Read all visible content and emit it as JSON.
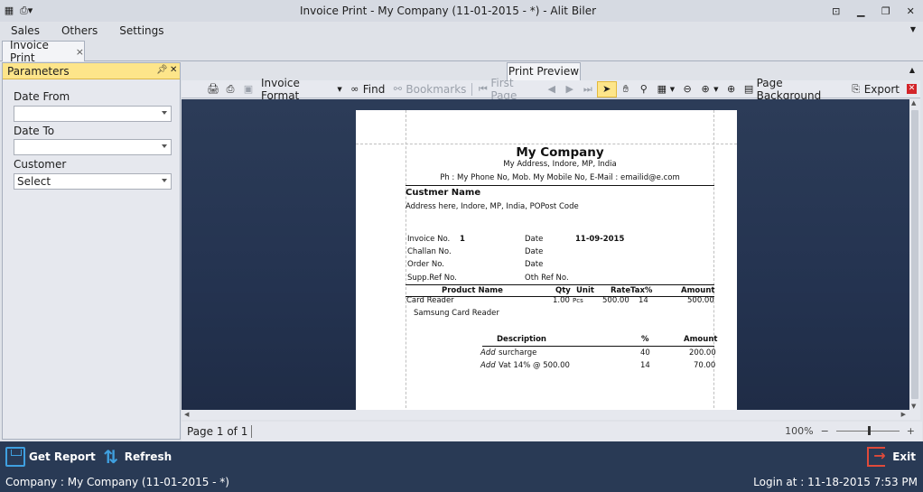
{
  "window": {
    "title": "Invoice Print - My Company (11-01-2015 - *) - Alit Biler",
    "controls": [
      "restore-down",
      "minimize",
      "maximize",
      "close"
    ]
  },
  "menu": {
    "items": [
      "Sales",
      "Others",
      "Settings"
    ]
  },
  "doc_tab": {
    "label": "Invoice Print",
    "close": "×"
  },
  "parameters": {
    "title": "Parameters",
    "date_from_label": "Date From",
    "date_from_value": "",
    "date_to_label": "Date To",
    "date_to_value": "",
    "customer_label": "Customer",
    "customer_value": "Select"
  },
  "preview": {
    "tab_label": "Print Preview",
    "toolbar": {
      "invoice_format": "Invoice Format",
      "find": "Find",
      "bookmarks": "Bookmarks",
      "first_page": "First Page",
      "page_background": "Page Background",
      "export": "Export"
    },
    "pager": "Page 1 of 1",
    "zoom": "100%",
    "zoom_level": 0.52
  },
  "invoice": {
    "company_name": "My Company",
    "address": "My Address, Indore, MP, India",
    "contact": "Ph : My Phone No, Mob. My Mobile No, E-Mail : emailid@e.com",
    "customer_name": "Custmer Name",
    "customer_address": "Address here, Indore, MP, India, POPost Code",
    "invoice_no_label": "Invoice No.",
    "invoice_no": "1",
    "date_label": "Date",
    "date": "11-09-2015",
    "challan_label": "Challan No.",
    "challan_date_label": "Date",
    "order_label": "Order No.",
    "order_date_label": "Date",
    "supp_ref_label": "Supp.Ref No.",
    "oth_ref_label": "Oth Ref No.",
    "items_header": {
      "product": "Product Name",
      "qty": "Qty",
      "unit": "Unit",
      "rate": "Rate",
      "tax": "Tax%",
      "amount": "Amount"
    },
    "item": {
      "product": "Card Reader",
      "qty": "1.00",
      "unit": "Pcs",
      "rate": "500.00",
      "tax": "14",
      "amount": "500.00",
      "description": "Samsung Card Reader"
    },
    "charges_header": {
      "description": "Description",
      "percent": "%",
      "amount": "Amount"
    },
    "charges": [
      {
        "add": "Add",
        "label": "surcharge",
        "percent": "40",
        "amount": "200.00"
      },
      {
        "add": "Add",
        "label": "Vat 14% @ 500.00",
        "percent": "14",
        "amount": "70.00"
      }
    ]
  },
  "actions": {
    "get_report": "Get Report",
    "refresh": "Refresh",
    "exit": "Exit"
  },
  "status": {
    "company": "Company : My Company  (11-01-2015 - *)",
    "login": "Login at : 11-18-2015 7:53 PM"
  },
  "colors": {
    "accent_yellow": "#fde58a",
    "dark_bar": "#293a55",
    "canvas": "#243350",
    "exit_red": "#e04a3a",
    "icon_blue": "#3fa0e0"
  }
}
